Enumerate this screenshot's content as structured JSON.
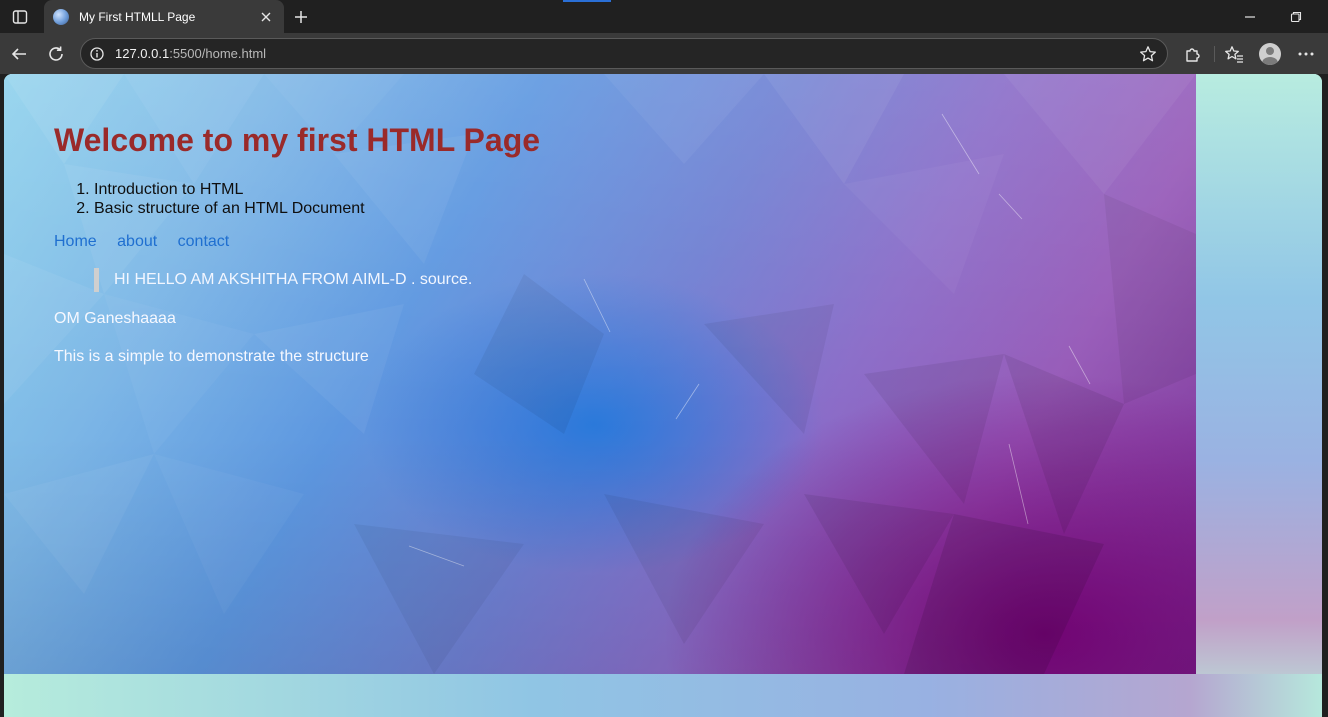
{
  "browser": {
    "tab_title": "My First HTMLL Page",
    "url_host": "127.0.0.1",
    "url_rest": ":5500/home.html",
    "accent_color": "#2a6fd6"
  },
  "page": {
    "heading": "Welcome to my first HTML Page",
    "heading_color": "#9a2a2a",
    "list_items": [
      "Introduction to HTML",
      "Basic structure of an HTML Document"
    ],
    "nav_links": [
      "Home",
      "about",
      "contact"
    ],
    "link_color": "#1f6fd0",
    "quote_text": "HI HELLO AM AKSHITHA FROM AIML-D . source.",
    "paragraphs": [
      "OM Ganeshaaaa",
      "This is a simple to demonstrate the structure"
    ]
  },
  "icons": {
    "sidebar": "sidebar-icon",
    "favicon": "globe-icon",
    "close": "close-icon",
    "new_tab": "plus-icon",
    "back": "back-arrow-icon",
    "refresh": "refresh-icon",
    "info": "info-icon",
    "favorite": "star-icon",
    "extensions": "puzzle-icon",
    "favorites": "favorites-icon",
    "profile": "profile-icon",
    "menu": "more-icon"
  }
}
